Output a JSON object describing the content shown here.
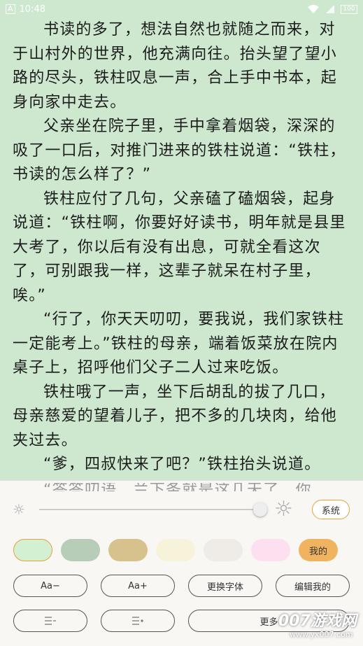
{
  "status_bar": {
    "time": "10:48",
    "font_indicator": "A",
    "battery_text": "100"
  },
  "reader": {
    "paragraphs": [
      "书读的多了，想法自然也就随之而来，对于山村外的世界，他充满向往。抬头望了望小路的尽头，铁柱叹息一声，合上手中书本，起身向家中走去。",
      "父亲坐在院子里，手中拿着烟袋，深深的吸了一口后，对推门进来的铁柱说道：“铁柱，书读的怎么样了？”",
      "铁柱应付了几句，父亲磕了磕烟袋，起身说道：“铁柱啊，你要好好读书，明年就是县里大考了，你以后有没有出息，可就全看这次了，可别跟我一样，这辈子就呆在村子里，唉。”",
      "“行了，你天天叨叨，要我说，我们家铁柱一定能考上。”铁柱的母亲，端着饭菜放在院内桌子上，招呼他们父子二人过来吃饭。",
      "铁柱哦了一声，坐下后胡乱的拔了几口，母亲慈爱的望着儿子，把不多的几块肉，给他夹过去。",
      "“爹，四叔快来了吧？”铁柱抬头说道。"
    ],
    "peek_text": "“答答叨语，兰下条就是这几天了，你"
  },
  "settings": {
    "brightness": 0.95,
    "system_label": "系统",
    "themes": [
      {
        "name": "green-light",
        "color": "#d3f0d2",
        "selected": true
      },
      {
        "name": "green-gray",
        "color": "#b8cdb8"
      },
      {
        "name": "tan",
        "color": "#d7c28e"
      },
      {
        "name": "cream",
        "color": "#f7f3da"
      },
      {
        "name": "light-gray",
        "color": "#efece7"
      },
      {
        "name": "pink",
        "color": "#fde0ef"
      }
    ],
    "mine_label": "我的",
    "font_smaller": "Aa−",
    "font_larger": "Aa+",
    "change_font": "更换字体",
    "edit_mine": "编辑我的",
    "more": "更多"
  },
  "watermark": {
    "main": "007游戏网",
    "url": "www.yx007.com"
  }
}
